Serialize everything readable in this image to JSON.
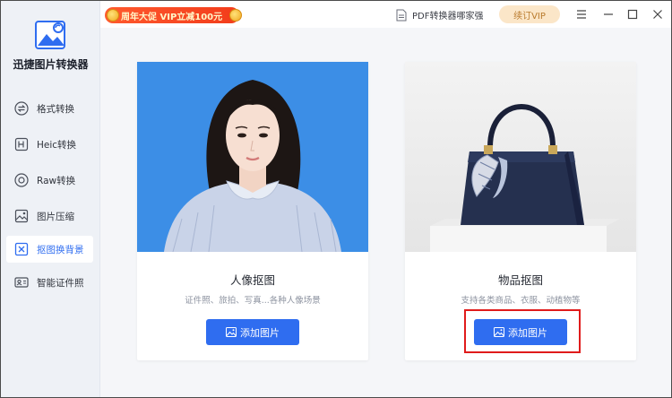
{
  "app": {
    "title": "迅捷图片转换器"
  },
  "sidebar": {
    "items": [
      {
        "label": "格式转换",
        "icon": "convert-icon"
      },
      {
        "label": "Heic转换",
        "icon": "heic-icon"
      },
      {
        "label": "Raw转换",
        "icon": "raw-icon"
      },
      {
        "label": "图片压缩",
        "icon": "compress-icon"
      },
      {
        "label": "抠图换背景",
        "icon": "cutout-icon",
        "active": true
      },
      {
        "label": "智能证件照",
        "icon": "id-photo-icon"
      }
    ]
  },
  "titlebar": {
    "promo": "周年大促 VIP立减100元",
    "pdf_link": "PDF转换器哪家强",
    "vip_button": "续订VIP"
  },
  "cards": [
    {
      "title": "人像抠图",
      "desc": "证件照、旅拍、写真...各种人像场景",
      "button": "添加图片"
    },
    {
      "title": "物品抠图",
      "desc": "支持各类商品、衣服、动植物等",
      "button": "添加图片"
    }
  ],
  "colors": {
    "accent": "#2f6df0",
    "portrait_bg": "#3c8ee6",
    "highlight": "#e01b1b"
  }
}
